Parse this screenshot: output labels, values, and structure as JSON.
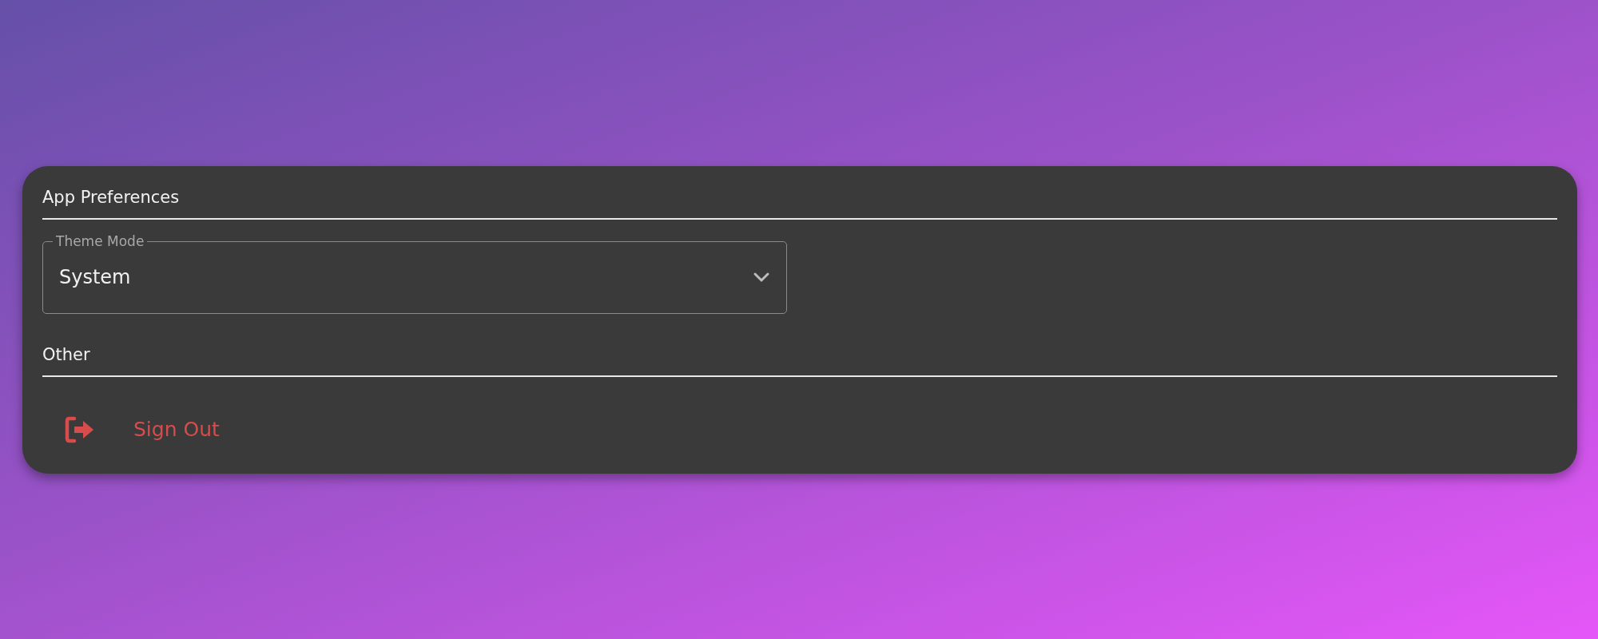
{
  "sections": [
    {
      "title": "App Preferences",
      "items": [
        {
          "kind": "select",
          "label": "Theme Mode",
          "value": "System"
        }
      ]
    },
    {
      "title": "Other",
      "items": [
        {
          "kind": "danger_action",
          "label": "Sign Out"
        }
      ]
    }
  ]
}
